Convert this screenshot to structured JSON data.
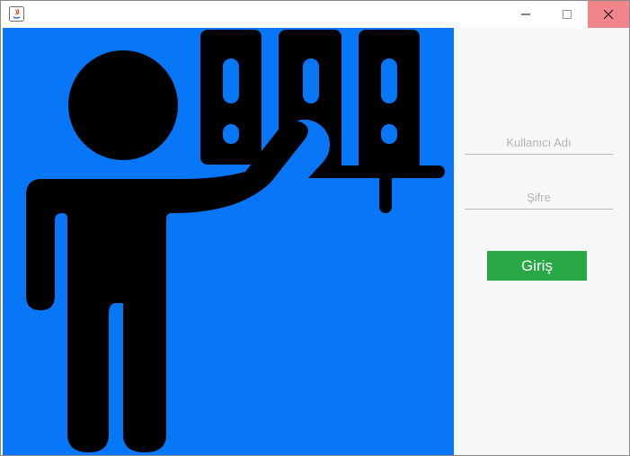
{
  "window": {
    "title": "",
    "controls": {
      "minimize_icon": "minimize-icon",
      "maximize_icon": "maximize-icon",
      "close_icon": "close-icon",
      "close_color": "#f0868c"
    }
  },
  "hero": {
    "background_color": "#0777f8",
    "illustration": "teacher-pointing-at-books-icon"
  },
  "login": {
    "username_placeholder": "Kullanıcı Adı",
    "password_placeholder": "Şifre",
    "submit_label": "Giriş",
    "submit_color": "#28a745"
  }
}
